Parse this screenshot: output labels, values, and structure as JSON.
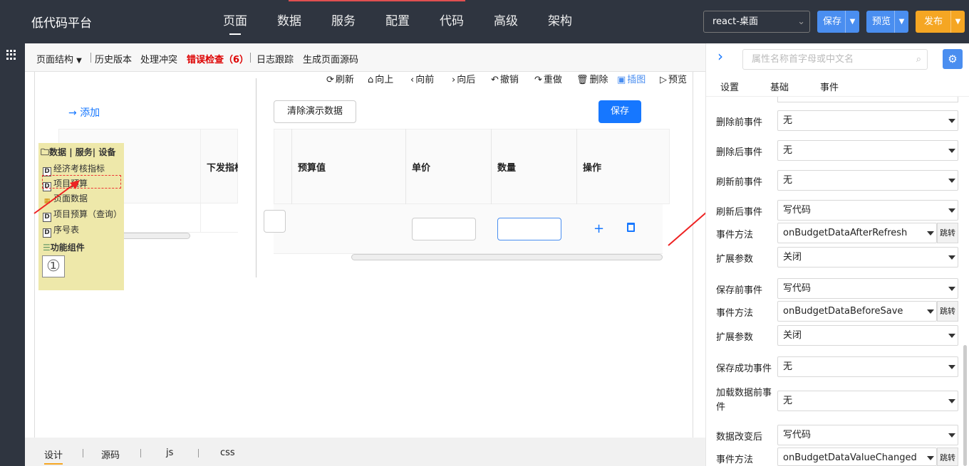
{
  "header": {
    "app_title": "低代码平台",
    "nav": [
      "页面",
      "数据",
      "服务",
      "配置",
      "代码",
      "高级",
      "架构"
    ],
    "active_nav": "页面",
    "env_select": "react-桌面",
    "save_label": "保存",
    "preview_label": "预览",
    "publish_label": "发布"
  },
  "toolbar": {
    "page_structure": "页面结构",
    "history": "历史版本",
    "conflicts": "处理冲突",
    "error_check": "错误检查（6）",
    "log_trace": "日志跟踪",
    "gen_source": "生成页面源码"
  },
  "actions": {
    "refresh": "刷新",
    "up": "向上",
    "forward": "向前",
    "backward": "向后",
    "undo": "撤销",
    "redo": "重做",
    "delete": "删除",
    "insert_image": "插图",
    "preview": "预览"
  },
  "left_table": {
    "add_label": "添加",
    "header_partial": "下发指标"
  },
  "main_table": {
    "clear_demo_label": "清除演示数据",
    "save_label": "保存",
    "columns": [
      "预算值",
      "单价",
      "数量",
      "操作"
    ]
  },
  "tree_panel": {
    "group_title": "数据 | 服务| 设备",
    "items": [
      "经济考核指标",
      "项目预算",
      "页面数据",
      "项目预算（查询）",
      "序号表"
    ],
    "functions_title": "功能组件",
    "badge": "①"
  },
  "right_panel": {
    "search_placeholder": "属性名称首字母或中文名",
    "tabs": [
      "设置",
      "基础",
      "事件"
    ],
    "jump_label": "跳转",
    "fields": [
      {
        "label": "删除前事件",
        "value": "无"
      },
      {
        "label": "删除后事件",
        "value": "无"
      },
      {
        "label": "刷新前事件",
        "value": "无"
      },
      {
        "label": "刷新后事件",
        "value": "写代码"
      },
      {
        "label": "事件方法",
        "value": "onBudgetDataAfterRefresh"
      },
      {
        "label": "扩展参数",
        "value": "关闭"
      },
      {
        "label": "保存前事件",
        "value": "写代码"
      },
      {
        "label": "事件方法",
        "value": "onBudgetDataBeforeSave"
      },
      {
        "label": "扩展参数",
        "value": "关闭"
      },
      {
        "label": "保存成功事件",
        "value": "无"
      },
      {
        "label": "加载数据前事件",
        "value": "无"
      },
      {
        "label": "数据改变后",
        "value": "写代码"
      },
      {
        "label": "事件方法",
        "value": "onBudgetDataValueChanged"
      }
    ]
  },
  "bottom_tabs": [
    "设计",
    "源码",
    "js",
    "css"
  ],
  "colors": {
    "topbar": "#2f3540",
    "primary": "#1677ff",
    "publish": "#f5a623",
    "error": "#dd0000",
    "annotation": "#ee2222"
  }
}
